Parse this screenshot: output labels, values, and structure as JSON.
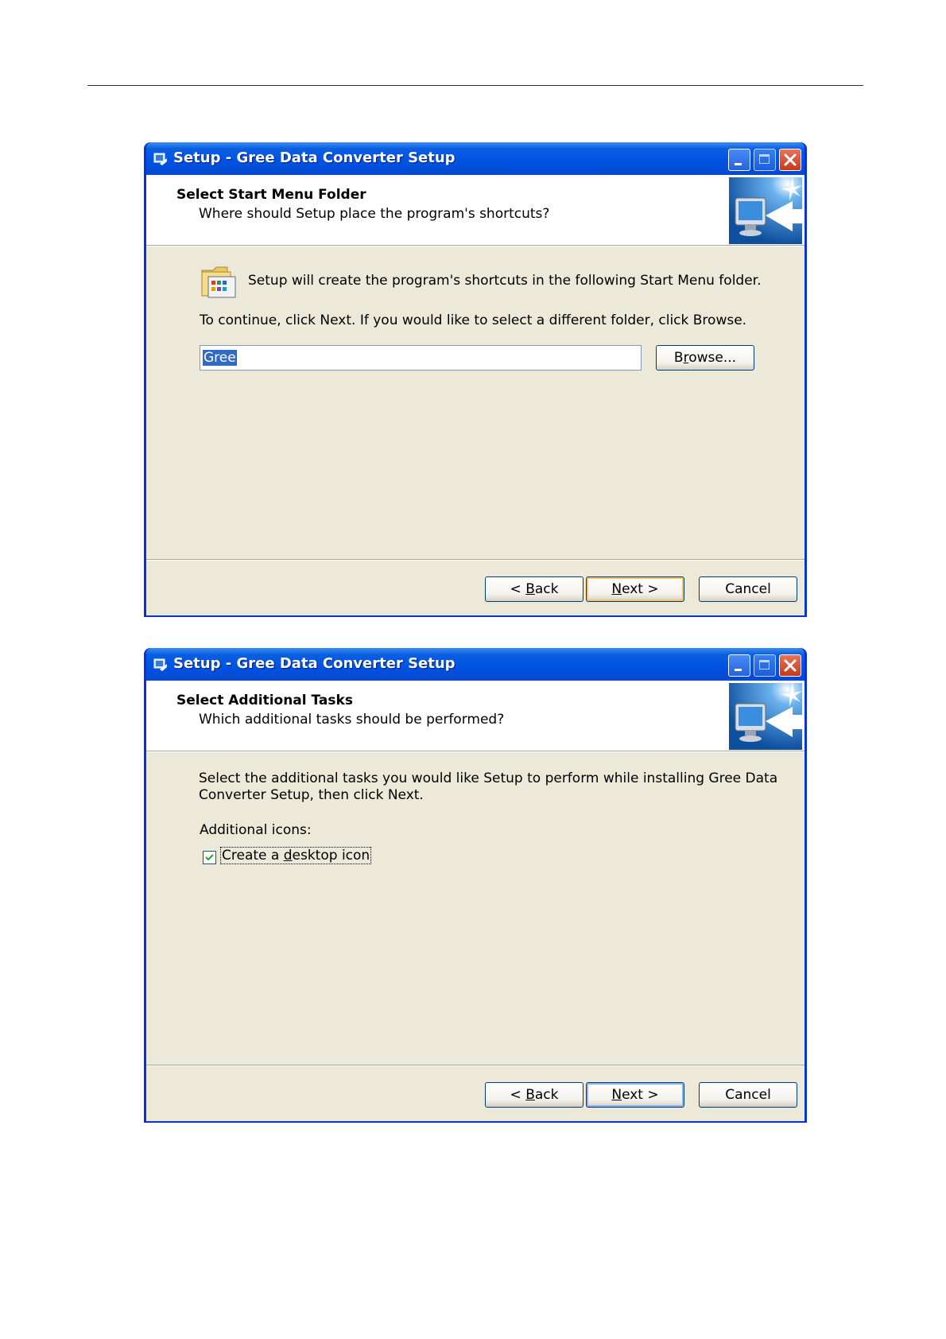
{
  "dialog1": {
    "title": "Setup - Gree Data Converter Setup",
    "header_title": "Select Start Menu Folder",
    "header_subtitle": "Where should Setup place the program's shortcuts?",
    "info_text": "Setup will create the program's shortcuts in the following Start Menu folder.",
    "instruction_text": "To continue, click Next. If you would like to select a different folder, click Browse.",
    "folder_value": "Gree",
    "browse_pre": "B",
    "browse_accel": "r",
    "browse_post": "owse...",
    "back_pre": "< ",
    "back_accel": "B",
    "back_post": "ack",
    "next_accel": "N",
    "next_post": "ext >",
    "cancel_label": "Cancel"
  },
  "dialog2": {
    "title": "Setup - Gree Data Converter Setup",
    "header_title": "Select Additional Tasks",
    "header_subtitle": "Which additional tasks should be performed?",
    "intro_line1": "Select the additional tasks you would like Setup to perform while installing Gree Data",
    "intro_line2": "Converter Setup, then click Next.",
    "group_label": "Additional icons:",
    "checkbox_pre": "Create a ",
    "checkbox_accel": "d",
    "checkbox_post": "esktop icon",
    "checkbox_checked": true,
    "back_pre": "< ",
    "back_accel": "B",
    "back_post": "ack",
    "next_accel": "N",
    "next_post": "ext >",
    "cancel_label": "Cancel"
  },
  "colors": {
    "titlebar": "#0054e3",
    "dialog_face": "#ece9d8",
    "selection": "#316ac5",
    "close_button": "#c7391b"
  },
  "icons": {
    "app": "setup-app-icon",
    "wizard": "wizard-computer-icon",
    "folder": "start-menu-folder-icon"
  }
}
